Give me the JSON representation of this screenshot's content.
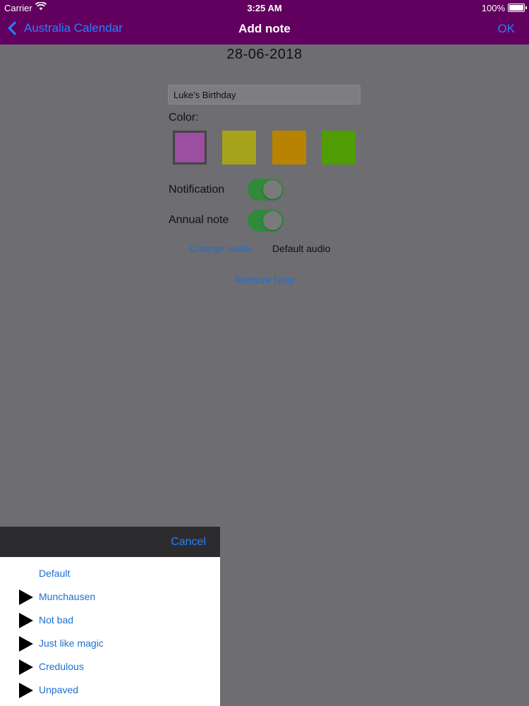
{
  "status_bar": {
    "carrier": "Carrier",
    "time": "3:25 AM",
    "battery": "100%"
  },
  "nav": {
    "back_label": "Australia Calendar",
    "title": "Add note",
    "ok_label": "OK"
  },
  "note": {
    "date": "28-06-2018",
    "title_value": "Luke's Birthday",
    "color_label": "Color:",
    "colors": [
      "#9b4fa0",
      "#a5a31b",
      "#b78300",
      "#4f9c05"
    ],
    "selected_color_index": 0,
    "notification_label": "Notification",
    "notification_on": true,
    "annual_label": "Annual note",
    "annual_on": true,
    "change_audio_label": "Change audio",
    "audio_value": "Default audio",
    "remove_label": "Remove Note"
  },
  "audio_sheet": {
    "cancel_label": "Cancel",
    "options": [
      {
        "label": "Default",
        "has_play": false
      },
      {
        "label": "Munchausen",
        "has_play": true
      },
      {
        "label": "Not bad",
        "has_play": true
      },
      {
        "label": "Just like magic",
        "has_play": true
      },
      {
        "label": "Credulous",
        "has_play": true
      },
      {
        "label": "Unpaved",
        "has_play": true
      }
    ]
  },
  "accent_color": "#2a7ffc",
  "nav_bar_color": "#62005f"
}
